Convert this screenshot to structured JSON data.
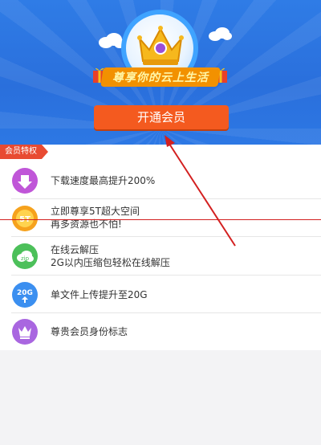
{
  "hero": {
    "banner_text": "尊享你的云上生活",
    "cta_label": "开通会员"
  },
  "privileges": {
    "tag": "会员特权",
    "items": [
      {
        "icon": "download-arrow-icon",
        "line1": "下载速度最高提升200%",
        "line2": ""
      },
      {
        "icon": "storage-5t-icon",
        "badge": "5T",
        "line1": "立即尊享5T超大空间",
        "line2": "再多资源也不怕!"
      },
      {
        "icon": "cloud-zip-icon",
        "badge": "zip",
        "line1": "在线云解压",
        "line2": "2G以内压缩包轻松在线解压"
      },
      {
        "icon": "upload-20g-icon",
        "badge": "20G",
        "line1": "单文件上传提升至20G",
        "line2": ""
      },
      {
        "icon": "vip-crown-icon",
        "line1": "尊贵会员身份标志",
        "line2": ""
      }
    ]
  },
  "colors": {
    "hero_bg": "#2f7ce6",
    "cta": "#f45a1f",
    "tag": "#e84b32",
    "annotation": "#d32020"
  }
}
